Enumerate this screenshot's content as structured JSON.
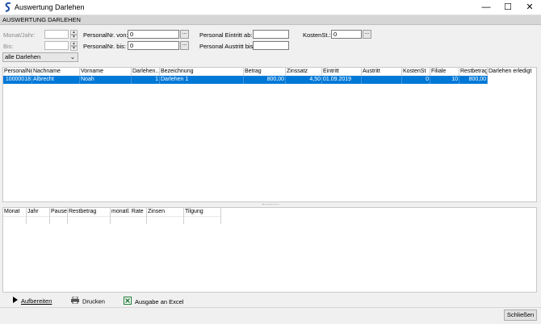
{
  "window": {
    "title": "Auswertung Darlehen",
    "minimize": "—",
    "maximize": "☐",
    "close": "✕"
  },
  "section_header": "AUSWERTUNG DARLEHEN",
  "filters": {
    "monat_jahr_label": "Monat/Jahr:",
    "bis_label": "Bis:",
    "status_combo": "alle Darlehen",
    "personal_von_label": "PersonalNr. von:",
    "personal_von_value": "0",
    "personal_bis_label": "PersonalNr. bis:",
    "personal_bis_value": "0",
    "eintritt_label": "Personal Eintritt ab:",
    "austritt_label": "Personal Austritt bis:",
    "kostenst_label": "KostenSt.:",
    "kostenst_value": "0",
    "dots": "..."
  },
  "main_table": {
    "headers": [
      "PersonalNr",
      "Nachname",
      "Vorname",
      "Darlehen...",
      "Bezeichnung",
      "Betrag",
      "Zinssatz",
      "Eintritt",
      "Austritt",
      "KostenSt",
      "Filiale",
      "Restbetrag",
      "Darlehen erledigt"
    ],
    "rows": [
      [
        "10000018",
        "Albrecht",
        "Noah",
        "1",
        "Darlehen 1",
        "800,00",
        "4,50",
        "01.09.2019",
        "",
        "0",
        "10",
        "800,00",
        ""
      ]
    ]
  },
  "sub_table": {
    "headers": [
      "Monat",
      "Jahr",
      "Pause",
      "Restbetrag",
      "monatl. Rate",
      "Zinsen",
      "Tilgung"
    ]
  },
  "actions": {
    "aufbereiten": "Aufbereiten",
    "drucken": "Drucken",
    "excel": "Ausgabe an Excel"
  },
  "footer": {
    "close_label": "Schließen"
  },
  "colors": {
    "selection": "#0078d7",
    "header_bar": "#d6d6d6",
    "excel_green": "#1e7a34"
  }
}
